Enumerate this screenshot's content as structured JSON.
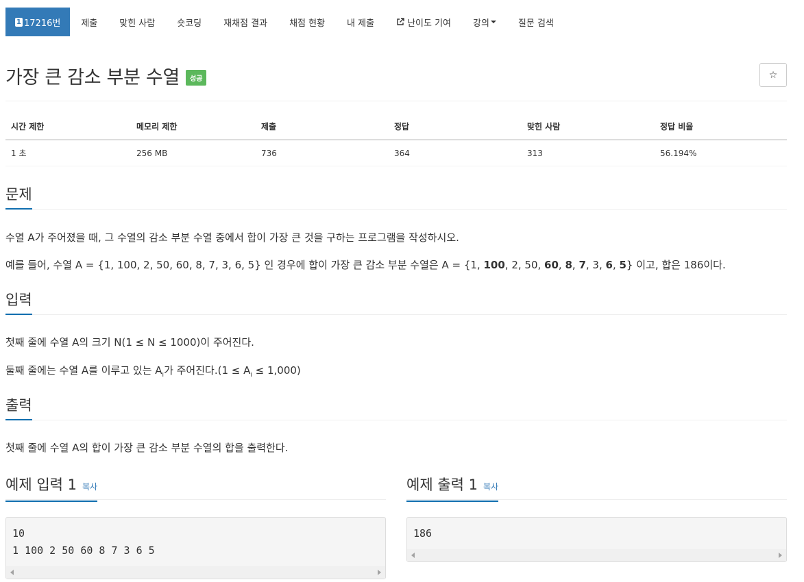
{
  "nav": {
    "problem_number": "17216번",
    "problem_badge": "1",
    "items": [
      "제출",
      "맞힌 사람",
      "숏코딩",
      "재채점 결과",
      "채점 현황",
      "내 제출",
      "난이도 기여",
      "강의"
    ],
    "last_item": "질문 검색"
  },
  "title": {
    "text": "가장 큰 감소 부분 수열",
    "status": "성공",
    "star": "☆"
  },
  "stats": {
    "headers": [
      "시간 제한",
      "메모리 제한",
      "제출",
      "정답",
      "맞힌 사람",
      "정답 비율"
    ],
    "values": [
      "1 초",
      "256 MB",
      "736",
      "364",
      "313",
      "56.194%"
    ]
  },
  "problem": {
    "heading": "문제",
    "line1": "수열 A가 주어졌을 때, 그 수열의 감소 부분 수열 중에서 합이 가장 큰 것을 구하는 프로그램을 작성하시오.",
    "line2_prefix": "예를 들어, 수열 A = {1, 100, 2, 50, 60, 8, 7, 3, 6, 5} 인 경우에 합이 가장 큰 감소 부분 수열은 A = {1, ",
    "b1": "100",
    "t1": ", 2, 50, ",
    "b2": "60",
    "t2": ", ",
    "b3": "8",
    "t3": ", ",
    "b4": "7",
    "t4": ", 3, ",
    "b5": "6",
    "t5": ", ",
    "b6": "5",
    "line2_suffix": "} 이고, 합은 186이다."
  },
  "input": {
    "heading": "입력",
    "line1": "첫째 줄에 수열 A의 크기 N(1 ≤ N ≤ 1000)이 주어진다.",
    "line2_a": "둘째 줄에는 수열 A를 이루고 있는 A",
    "line2_sub1": "i",
    "line2_b": "가 주어진다.(1 ≤ A",
    "line2_sub2": "i",
    "line2_c": " ≤ 1,000)"
  },
  "output": {
    "heading": "출력",
    "line1": "첫째 줄에 수열 A의 합이 가장 큰 감소 부분 수열의 합을 출력한다."
  },
  "sample_input": {
    "heading": "예제 입력 1",
    "copy": "복사",
    "text": "10\n1 100 2 50 60 8 7 3 6 5"
  },
  "sample_output": {
    "heading": "예제 출력 1",
    "copy": "복사",
    "text": "186"
  },
  "colors": {
    "accent": "#337ab7",
    "success": "#5cb85c",
    "underline": "#0f6eaf"
  }
}
